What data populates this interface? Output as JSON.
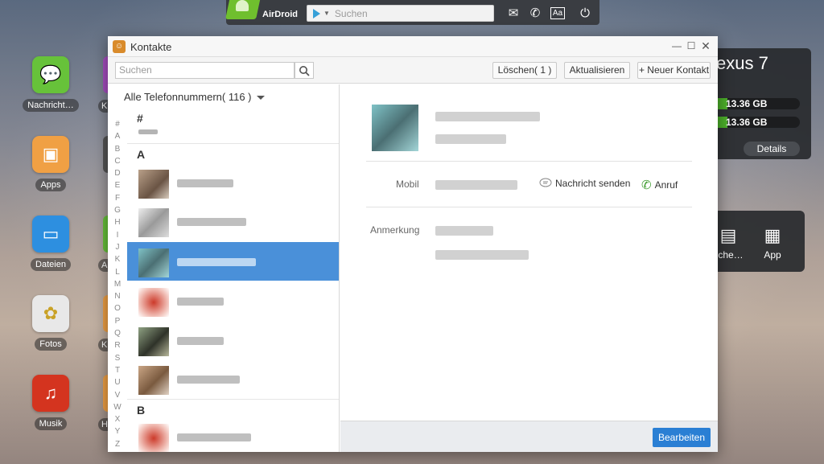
{
  "topbar": {
    "app_name": "AirDroid",
    "search_placeholder": "Suchen"
  },
  "dock": [
    {
      "label": "Nachricht…",
      "icon": "message-icon",
      "color": "#67c23a"
    },
    {
      "label": "Apps",
      "icon": "apps-box-icon",
      "color": "#f0a044"
    },
    {
      "label": "Dateien",
      "icon": "folder-icon",
      "color": "#2d8fe0"
    },
    {
      "label": "Fotos",
      "icon": "photos-icon",
      "color": "#e8e8e8"
    },
    {
      "label": "Musik",
      "icon": "music-icon",
      "color": "#d4341f"
    }
  ],
  "dock_peek_labels": [
    "K",
    "A",
    "K",
    "H"
  ],
  "device": {
    "name": "exus 7",
    "storage1": "13.36 GB",
    "storage2": "13.36 GB",
    "details_label": "Details"
  },
  "tools": [
    {
      "label": "sche…",
      "icon": "clipboard-icon"
    },
    {
      "label": "App",
      "icon": "app-box-icon"
    }
  ],
  "window": {
    "title": "Kontakte",
    "search_placeholder": "Suchen",
    "delete_label": "Löschen( 1 )",
    "refresh_label": "Aktualisieren",
    "new_contact_label": "+ Neuer Kontakt",
    "filter_label": "Alle Telefonnummern( 116 )",
    "alpha_index": [
      "#",
      "A",
      "B",
      "C",
      "D",
      "E",
      "F",
      "G",
      "H",
      "I",
      "J",
      "K",
      "L",
      "M",
      "N",
      "O",
      "P",
      "Q",
      "R",
      "S",
      "T",
      "U",
      "V",
      "W",
      "X",
      "Y",
      "Z"
    ],
    "sections": [
      "#",
      "A",
      "B"
    ],
    "detail": {
      "mobile_label": "Mobil",
      "send_message_label": "Nachricht senden",
      "call_label": "Anruf",
      "note_label": "Anmerkung"
    },
    "edit_label": "Bearbeiten"
  },
  "colors": {
    "accent": "#2a7fd4",
    "selection": "#4a90d9",
    "storage_green": "#4caf2a"
  }
}
